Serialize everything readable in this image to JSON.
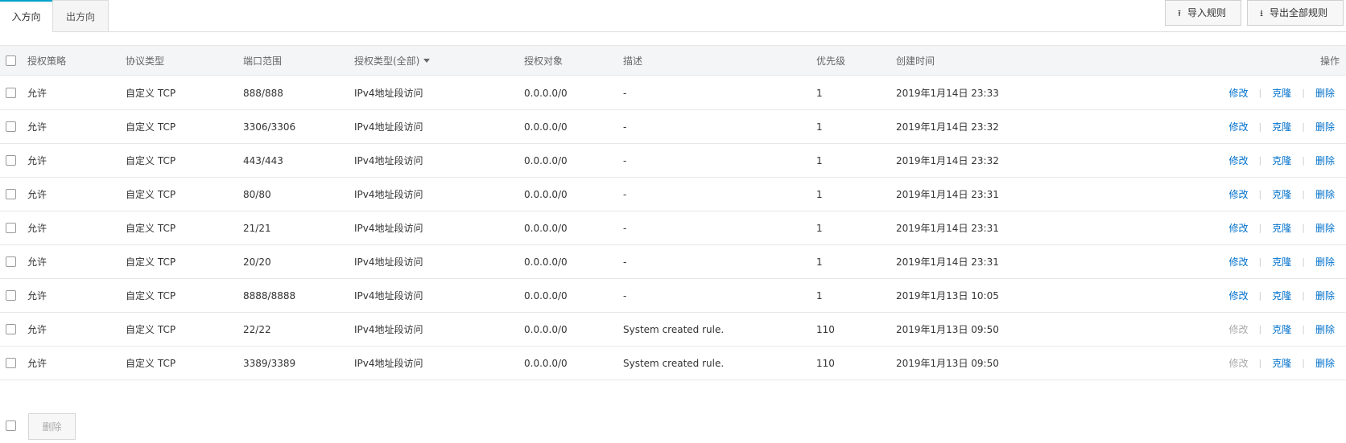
{
  "tabs": [
    {
      "label": "入方向",
      "active": true
    },
    {
      "label": "出方向",
      "active": false
    }
  ],
  "actions": {
    "import_label": "导入规则",
    "export_label": "导出全部规则",
    "import_icon": "upload-icon",
    "export_icon": "download-icon"
  },
  "table": {
    "headers": {
      "policy": "授权策略",
      "protocol": "协议类型",
      "port": "端口范围",
      "auth_type": "授权类型(全部)",
      "object": "授权对象",
      "description": "描述",
      "priority": "优先级",
      "created": "创建时间",
      "ops": "操作"
    },
    "ops_labels": {
      "modify": "修改",
      "clone": "克隆",
      "delete": "删除",
      "separator": "|"
    },
    "rows": [
      {
        "policy": "允许",
        "protocol": "自定义 TCP",
        "port": "888/888",
        "auth_type": "IPv4地址段访问",
        "object": "0.0.0.0/0",
        "description": "-",
        "priority": "1",
        "created": "2019年1月14日 23:33",
        "modify_enabled": true
      },
      {
        "policy": "允许",
        "protocol": "自定义 TCP",
        "port": "3306/3306",
        "auth_type": "IPv4地址段访问",
        "object": "0.0.0.0/0",
        "description": "-",
        "priority": "1",
        "created": "2019年1月14日 23:32",
        "modify_enabled": true
      },
      {
        "policy": "允许",
        "protocol": "自定义 TCP",
        "port": "443/443",
        "auth_type": "IPv4地址段访问",
        "object": "0.0.0.0/0",
        "description": "-",
        "priority": "1",
        "created": "2019年1月14日 23:32",
        "modify_enabled": true
      },
      {
        "policy": "允许",
        "protocol": "自定义 TCP",
        "port": "80/80",
        "auth_type": "IPv4地址段访问",
        "object": "0.0.0.0/0",
        "description": "-",
        "priority": "1",
        "created": "2019年1月14日 23:31",
        "modify_enabled": true
      },
      {
        "policy": "允许",
        "protocol": "自定义 TCP",
        "port": "21/21",
        "auth_type": "IPv4地址段访问",
        "object": "0.0.0.0/0",
        "description": "-",
        "priority": "1",
        "created": "2019年1月14日 23:31",
        "modify_enabled": true
      },
      {
        "policy": "允许",
        "protocol": "自定义 TCP",
        "port": "20/20",
        "auth_type": "IPv4地址段访问",
        "object": "0.0.0.0/0",
        "description": "-",
        "priority": "1",
        "created": "2019年1月14日 23:31",
        "modify_enabled": true
      },
      {
        "policy": "允许",
        "protocol": "自定义 TCP",
        "port": "8888/8888",
        "auth_type": "IPv4地址段访问",
        "object": "0.0.0.0/0",
        "description": "-",
        "priority": "1",
        "created": "2019年1月13日 10:05",
        "modify_enabled": true
      },
      {
        "policy": "允许",
        "protocol": "自定义 TCP",
        "port": "22/22",
        "auth_type": "IPv4地址段访问",
        "object": "0.0.0.0/0",
        "description": "System created rule.",
        "priority": "110",
        "created": "2019年1月13日 09:50",
        "modify_enabled": false
      },
      {
        "policy": "允许",
        "protocol": "自定义 TCP",
        "port": "3389/3389",
        "auth_type": "IPv4地址段访问",
        "object": "0.0.0.0/0",
        "description": "System created rule.",
        "priority": "110",
        "created": "2019年1月13日 09:50",
        "modify_enabled": false
      }
    ]
  },
  "footer": {
    "delete_label": "删除"
  },
  "colors": {
    "accent": "#00a2ca",
    "link": "#0070cc",
    "disabled": "#aaaaaa"
  }
}
